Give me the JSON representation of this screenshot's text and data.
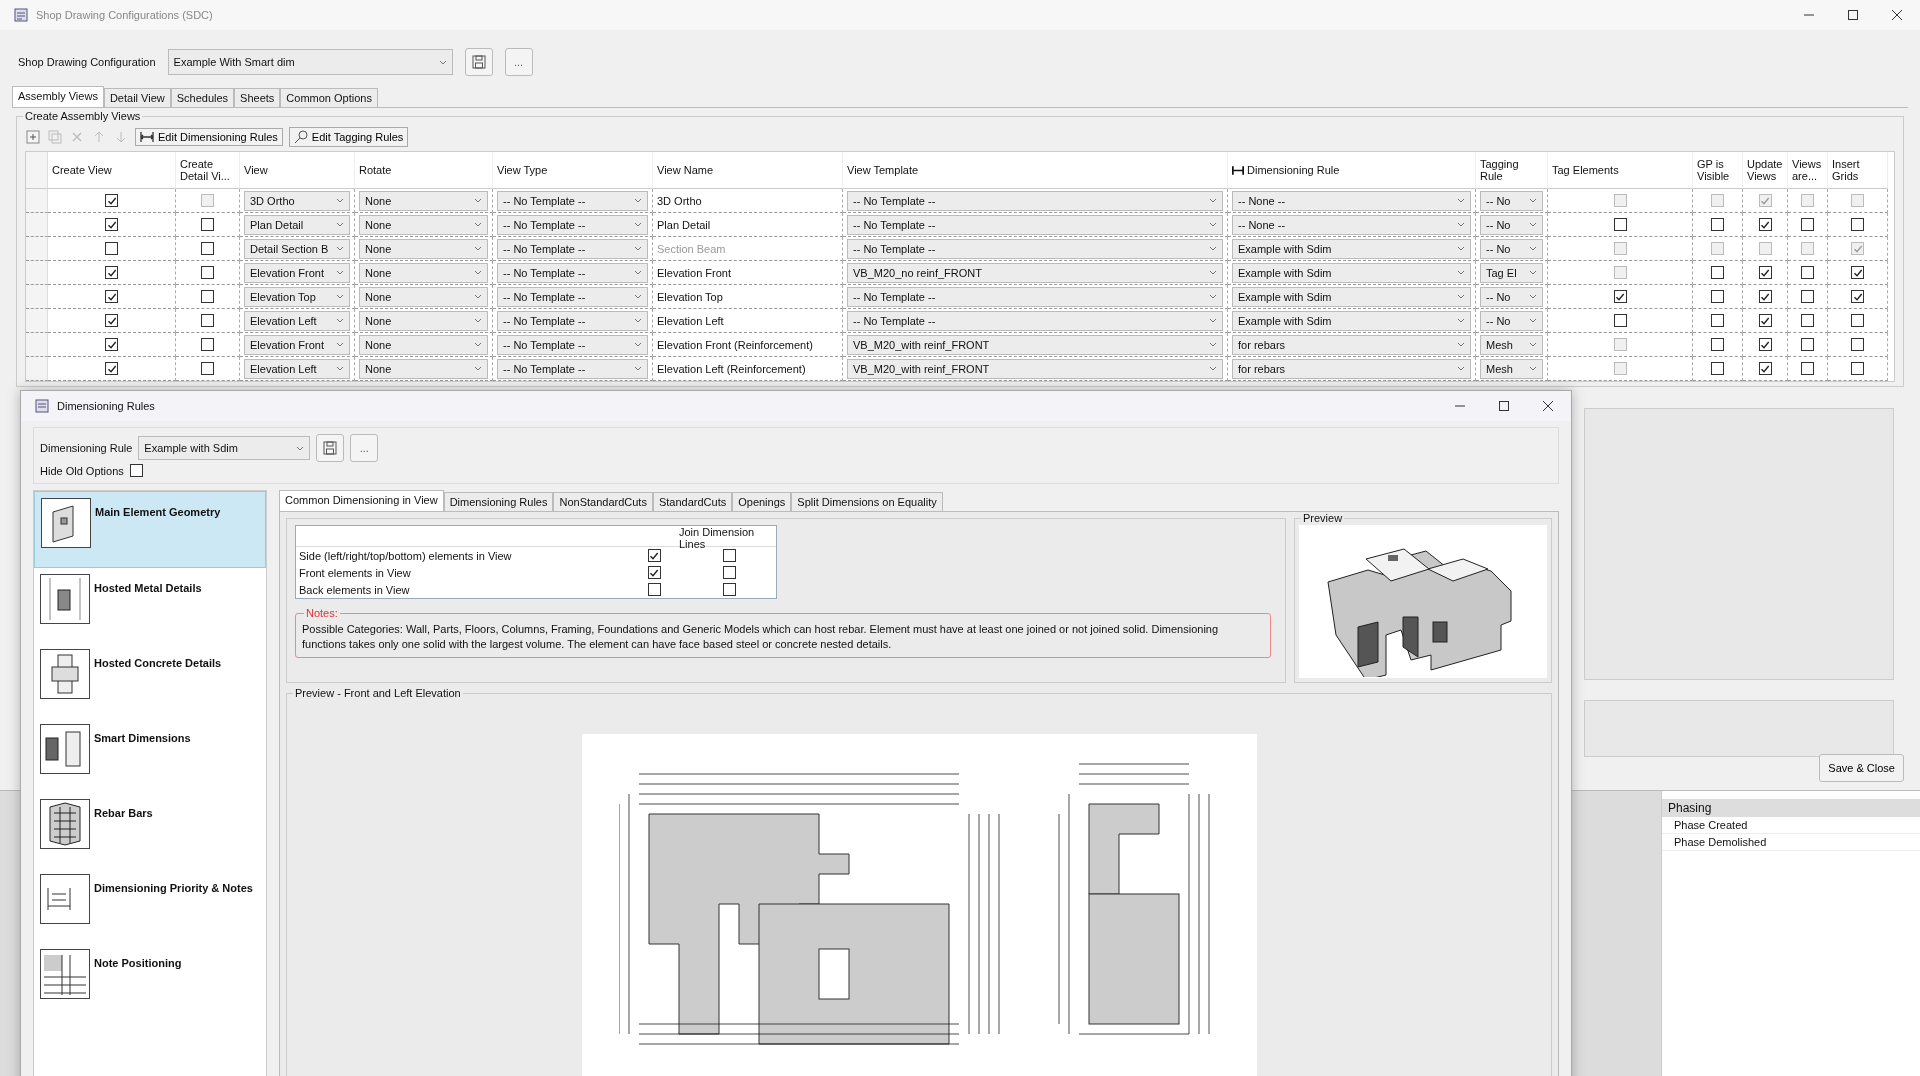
{
  "window": {
    "title": "Shop Drawing Configurations (SDC)"
  },
  "config": {
    "label": "Shop Drawing Configuration",
    "value": "Example With Smart dim",
    "more_button": "..."
  },
  "tabs": [
    {
      "label": "Assembly Views",
      "selected": true
    },
    {
      "label": "Detail View",
      "selected": false
    },
    {
      "label": "Schedules",
      "selected": false
    },
    {
      "label": "Sheets",
      "selected": false
    },
    {
      "label": "Common Options",
      "selected": false
    }
  ],
  "group_title": "Create Assembly Views",
  "toolbar": [
    {
      "label": "Edit Dimensioning Rules",
      "kind": "dimension"
    },
    {
      "label": "Edit Tagging Rules",
      "kind": "tag"
    }
  ],
  "table": {
    "columns": [
      {
        "label": "Create View",
        "kind": "text"
      },
      {
        "label": "Create Detail Vi...",
        "kind": "text"
      },
      {
        "label": "View",
        "kind": "text"
      },
      {
        "label": "Rotate",
        "kind": "text"
      },
      {
        "label": "View Type",
        "kind": "text"
      },
      {
        "label": "View Name",
        "kind": "text"
      },
      {
        "label": "View Template",
        "kind": "text"
      },
      {
        "label": "Dimensioning Rule",
        "kind": "dimension"
      },
      {
        "label": "Tagging Rule",
        "kind": "text"
      },
      {
        "label": "Tag Elements",
        "kind": "text"
      },
      {
        "label": "GP is Visible",
        "kind": "text"
      },
      {
        "label": "Update Views",
        "kind": "text"
      },
      {
        "label": "Views are...",
        "kind": "text"
      },
      {
        "label": "Insert Grids",
        "kind": "text"
      }
    ],
    "rows": [
      {
        "create_view": {
          "checked": true,
          "disabled": false
        },
        "create_detail": {
          "checked": false,
          "disabled": true
        },
        "view": "3D Ortho",
        "rotate": "None",
        "view_type": "-- No Template --",
        "view_name": {
          "text": "3D Ortho",
          "disabled": false
        },
        "view_template": "-- No Template --",
        "dimensioning_rule": "-- None --",
        "tagging_rule": "-- No",
        "tag_elements": {
          "checked": false,
          "disabled": true
        },
        "gp_visible": {
          "checked": false,
          "disabled": true
        },
        "update_views": {
          "checked": true,
          "disabled": true
        },
        "views_are": {
          "checked": false,
          "disabled": true
        },
        "insert_grids": {
          "checked": false,
          "disabled": true
        }
      },
      {
        "create_view": {
          "checked": true,
          "disabled": false
        },
        "create_detail": {
          "checked": false,
          "disabled": false
        },
        "view": "Plan Detail",
        "rotate": "None",
        "view_type": "-- No Template --",
        "view_name": {
          "text": "Plan Detail",
          "disabled": false
        },
        "view_template": "-- No Template --",
        "dimensioning_rule": "-- None --",
        "tagging_rule": "-- No",
        "tag_elements": {
          "checked": false,
          "disabled": false
        },
        "gp_visible": {
          "checked": false,
          "disabled": false
        },
        "update_views": {
          "checked": true,
          "disabled": false
        },
        "views_are": {
          "checked": false,
          "disabled": false
        },
        "insert_grids": {
          "checked": false,
          "disabled": false
        }
      },
      {
        "create_view": {
          "checked": false,
          "disabled": false
        },
        "create_detail": {
          "checked": false,
          "disabled": false
        },
        "view": "Detail Section B",
        "rotate": "None",
        "view_type": "-- No Template --",
        "view_name": {
          "text": "Section Beam",
          "disabled": true
        },
        "view_template": "-- No Template --",
        "dimensioning_rule": "Example with Sdim",
        "tagging_rule": "-- No",
        "tag_elements": {
          "checked": false,
          "disabled": true
        },
        "gp_visible": {
          "checked": false,
          "disabled": true
        },
        "update_views": {
          "checked": false,
          "disabled": true
        },
        "views_are": {
          "checked": false,
          "disabled": true
        },
        "insert_grids": {
          "checked": true,
          "disabled": true
        }
      },
      {
        "create_view": {
          "checked": true,
          "disabled": false
        },
        "create_detail": {
          "checked": false,
          "disabled": false
        },
        "view": "Elevation Front",
        "rotate": "None",
        "view_type": "-- No Template --",
        "view_name": {
          "text": "Elevation Front",
          "disabled": false
        },
        "view_template": "VB_M20_no reinf_FRONT",
        "dimensioning_rule": "Example with Sdim",
        "tagging_rule": "Tag El",
        "tag_elements": {
          "checked": false,
          "disabled": true
        },
        "gp_visible": {
          "checked": false,
          "disabled": false
        },
        "update_views": {
          "checked": true,
          "disabled": false
        },
        "views_are": {
          "checked": false,
          "disabled": false
        },
        "insert_grids": {
          "checked": true,
          "disabled": false
        }
      },
      {
        "create_view": {
          "checked": true,
          "disabled": false
        },
        "create_detail": {
          "checked": false,
          "disabled": false
        },
        "view": "Elevation Top",
        "rotate": "None",
        "view_type": "-- No Template --",
        "view_name": {
          "text": "Elevation Top",
          "disabled": false
        },
        "view_template": "-- No Template --",
        "dimensioning_rule": "Example with Sdim",
        "tagging_rule": "-- No",
        "tag_elements": {
          "checked": true,
          "disabled": false
        },
        "gp_visible": {
          "checked": false,
          "disabled": false
        },
        "update_views": {
          "checked": true,
          "disabled": false
        },
        "views_are": {
          "checked": false,
          "disabled": false
        },
        "insert_grids": {
          "checked": true,
          "disabled": false
        }
      },
      {
        "create_view": {
          "checked": true,
          "disabled": false
        },
        "create_detail": {
          "checked": false,
          "disabled": false
        },
        "view": "Elevation Left",
        "rotate": "None",
        "view_type": "-- No Template --",
        "view_name": {
          "text": "Elevation Left",
          "disabled": false
        },
        "view_template": "-- No Template --",
        "dimensioning_rule": "Example with Sdim",
        "tagging_rule": "-- No",
        "tag_elements": {
          "checked": false,
          "disabled": false
        },
        "gp_visible": {
          "checked": false,
          "disabled": false
        },
        "update_views": {
          "checked": true,
          "disabled": false
        },
        "views_are": {
          "checked": false,
          "disabled": false
        },
        "insert_grids": {
          "checked": false,
          "disabled": false
        }
      },
      {
        "create_view": {
          "checked": true,
          "disabled": false
        },
        "create_detail": {
          "checked": false,
          "disabled": false
        },
        "view": "Elevation Front",
        "rotate": "None",
        "view_type": "-- No Template --",
        "view_name": {
          "text": "Elevation Front (Reinforcement)",
          "disabled": false
        },
        "view_template": "VB_M20_with reinf_FRONT",
        "dimensioning_rule": "for rebars",
        "tagging_rule": "Mesh",
        "tag_elements": {
          "checked": false,
          "disabled": true
        },
        "gp_visible": {
          "checked": false,
          "disabled": false
        },
        "update_views": {
          "checked": true,
          "disabled": false
        },
        "views_are": {
          "checked": false,
          "disabled": false
        },
        "insert_grids": {
          "checked": false,
          "disabled": false
        }
      },
      {
        "create_view": {
          "checked": true,
          "disabled": false
        },
        "create_detail": {
          "checked": false,
          "disabled": false
        },
        "view": "Elevation Left",
        "rotate": "None",
        "view_type": "-- No Template --",
        "view_name": {
          "text": "Elevation Left (Reinforcement)",
          "disabled": false
        },
        "view_template": "VB_M20_with reinf_FRONT",
        "dimensioning_rule": "for rebars",
        "tagging_rule": "Mesh",
        "tag_elements": {
          "checked": false,
          "disabled": true
        },
        "gp_visible": {
          "checked": false,
          "disabled": false
        },
        "update_views": {
          "checked": true,
          "disabled": false
        },
        "views_are": {
          "checked": false,
          "disabled": false
        },
        "insert_grids": {
          "checked": false,
          "disabled": false
        }
      }
    ]
  },
  "save_button": "Save & Close",
  "properties": {
    "group": "Phasing",
    "items": [
      "Phase Created",
      "Phase Demolished"
    ]
  },
  "dialog": {
    "title": "Dimensioning Rules",
    "rule_label": "Dimensioning Rule",
    "rule_value": "Example with Sdim",
    "more_button": "...",
    "hide_old_options": {
      "label": "Hide Old Options",
      "checked": false
    },
    "categories": [
      {
        "label": "Main Element Geometry",
        "selected": true
      },
      {
        "label": "Hosted Metal Details",
        "selected": false
      },
      {
        "label": "Hosted Concrete Details",
        "selected": false
      },
      {
        "label": "Smart Dimensions",
        "selected": false
      },
      {
        "label": "Rebar Bars",
        "selected": false
      },
      {
        "label": "Dimensioning Priority & Notes",
        "selected": false
      },
      {
        "label": "Note Positioning",
        "selected": false
      }
    ],
    "tabs": [
      {
        "label": "Common Dimensioning in View",
        "selected": true
      },
      {
        "label": "Dimensioning Rules",
        "selected": false
      },
      {
        "label": "NonStandardCuts",
        "selected": false
      },
      {
        "label": "StandardCuts",
        "selected": false
      },
      {
        "label": "Openings",
        "selected": false
      },
      {
        "label": "Split Dimensions on Equality",
        "selected": false
      }
    ],
    "options": {
      "column": "Join Dimension Lines",
      "rows": [
        {
          "label": "Side (left/right/top/bottom) elements in View",
          "checked": true,
          "join": false
        },
        {
          "label": "Front elements in View",
          "checked": true,
          "join": false
        },
        {
          "label": "Back elements in View",
          "checked": false,
          "join": false
        }
      ]
    },
    "notes": {
      "title": "Notes:",
      "text": "Possible Categories: Wall, Parts, Floors, Columns, Framing, Foundations and Generic Models which can host rebar. Element must have at least one joined or not joined solid. Dimensioning functions takes only one solid with the largest volume. The element can have face based steel or concrete nested details."
    },
    "preview_title": "Preview",
    "elevation_title": "Preview - Front and Left Elevation"
  }
}
